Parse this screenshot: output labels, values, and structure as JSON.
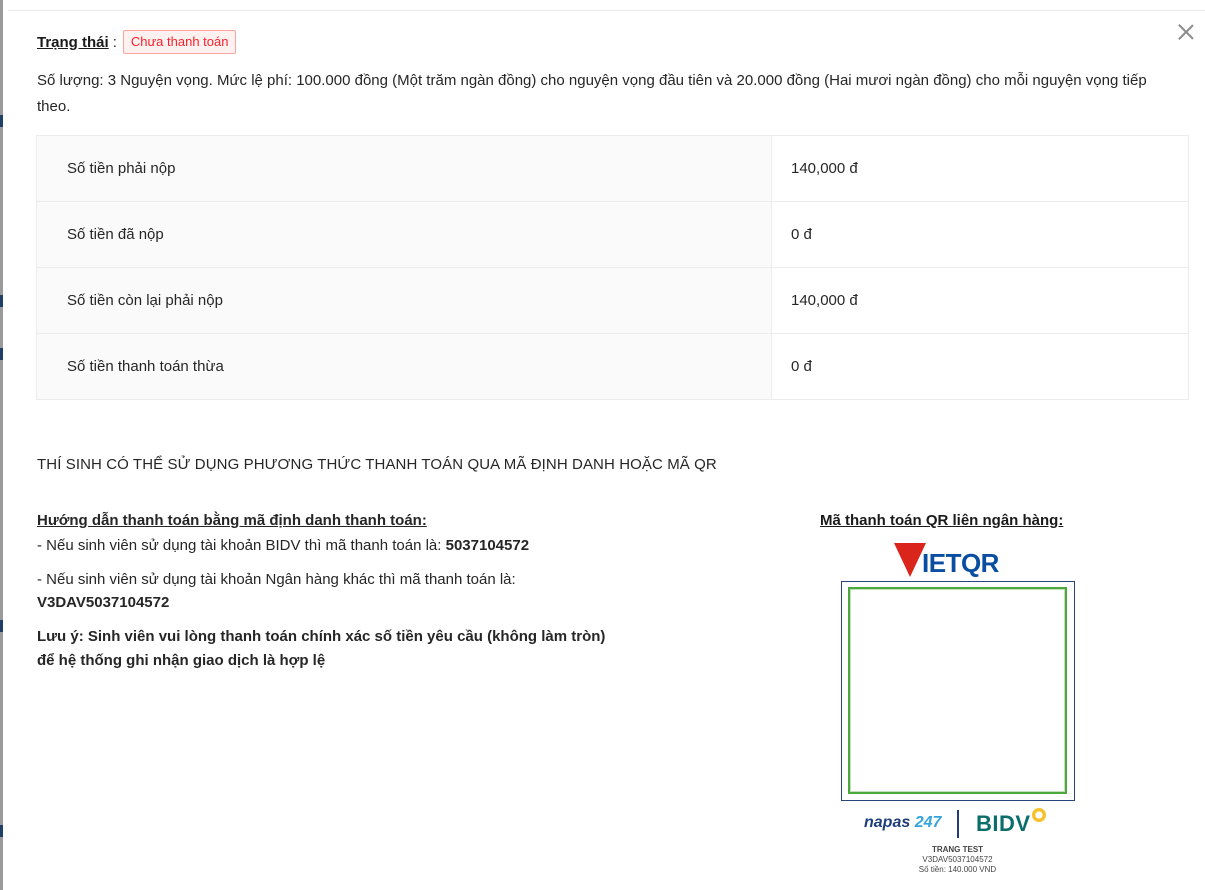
{
  "status": {
    "label": "Trạng thái",
    "colon": ":",
    "tag": "Chưa thanh toán",
    "tag_color": "#f5222d"
  },
  "description": "Số lượng: 3 Nguyện vọng. Mức lệ phí: 100.000 đồng (Một trăm ngàn đồng) cho nguyện vọng đầu tiên và 20.000 đồng (Hai mươi ngàn đồng) cho mỗi nguyện vọng tiếp theo.",
  "fees": [
    {
      "label": "Số tiền phải nộp",
      "value": "140,000 đ"
    },
    {
      "label": "Số tiền đã nộp",
      "value": "0 đ"
    },
    {
      "label": "Số tiền còn lại phải nộp",
      "value": "140,000 đ"
    },
    {
      "label": "Số tiền thanh toán thừa",
      "value": "0 đ"
    }
  ],
  "notice": "THÍ SINH CÓ THỂ SỬ DỤNG PHƯƠNG THỨC THANH TOÁN QUA MÃ ĐỊNH DANH HOẶC MÃ QR",
  "guide": {
    "title": "Hướng dẫn thanh toán bằng mã định danh thanh toán:",
    "bidv_text": "- Nếu sinh viên sử dụng tài khoản BIDV thì mã thanh toán là: ",
    "bidv_code": "5037104572",
    "other_text": "- Nếu sinh viên sử dụng tài khoản Ngân hàng khác thì mã thanh toán là:",
    "other_code": "V3DAV5037104572",
    "note_line1": "Lưu ý: Sinh viên vui lòng thanh toán chính xác số tiền yêu cầu (không làm tròn)",
    "note_line2": "để hệ thống ghi nhận giao dịch là hợp lệ"
  },
  "qr": {
    "title": "Mã thanh toán QR liên ngân hàng:",
    "logo_text": "IETQR",
    "napas": "napas",
    "napas_247": "247",
    "bank": "BIDV",
    "holder": "TRANG TEST",
    "code": "V3DAV5037104572",
    "amount": "Số tiền: 140.000 VND",
    "frame_color": "#27457a",
    "inner_color": "#4aa83d"
  },
  "icons": {
    "close": "close-icon",
    "bidv_flower": "bidv-flower-icon"
  }
}
